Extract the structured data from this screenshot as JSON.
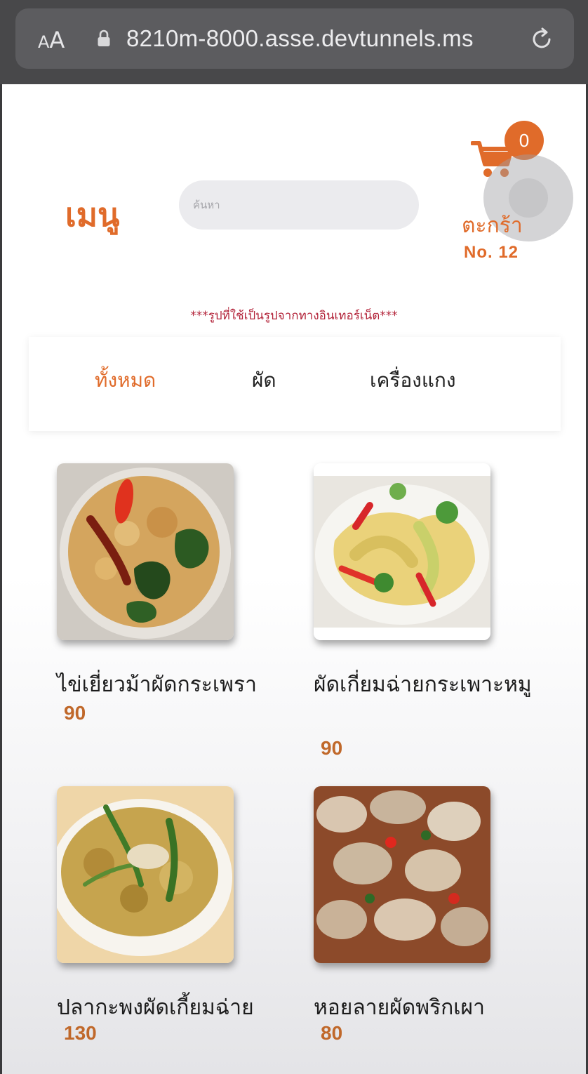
{
  "browser": {
    "aa_label_small": "A",
    "aa_label_big": "A",
    "url": "8210m-8000.asse.devtunnels.ms",
    "lock_icon": "lock-icon",
    "reload_icon": "reload-icon"
  },
  "header": {
    "title": "เมนู",
    "search_placeholder": "ค้นหา",
    "cart_count": "0",
    "cart_label": "ตะกร้า",
    "table_no": "No. 12",
    "cart_icon": "shopping-cart-icon"
  },
  "notice": "***รูปที่ใช้เป็นรูปจากทางอินเทอร์เน็ต***",
  "tabs": [
    {
      "label": "ทั้งหมด",
      "active": true
    },
    {
      "label": "ผัด",
      "active": false
    },
    {
      "label": "เครื่องแกง",
      "active": false
    }
  ],
  "menu_items": [
    {
      "name": "ไข่เยี่ยวม้าผัดกระเพรา",
      "price": "90"
    },
    {
      "name": "ผัดเกี่ยมฉ่ายกระเพาะหมู",
      "price": "90"
    },
    {
      "name": "ปลากะพงผัดเกี้ยมฉ่าย",
      "price": "130"
    },
    {
      "name": "หอยลายผัดพริกเผา",
      "price": "80"
    }
  ],
  "colors": {
    "accent": "#e06b2a",
    "notice": "#b3243a",
    "price": "#c0682a"
  }
}
